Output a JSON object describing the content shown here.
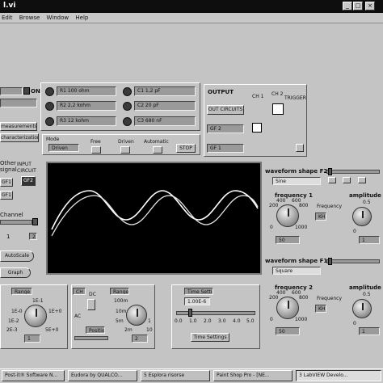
{
  "window": {
    "title": "l.vi",
    "btn_min": "_",
    "btn_max": "□",
    "btn_close": "×"
  },
  "menu": [
    "Edit",
    "Browse",
    "Window",
    "Help"
  ],
  "left": {
    "on_label": "ON",
    "measurements": "measurements",
    "characterization": "characterization",
    "other": "Other",
    "signal": "signal",
    "input_circuit": "INPUT CIRCUIT",
    "ch1": "CH 1",
    "gf1": "GF1",
    "gf2": "GF2",
    "gf1b": "GF1",
    "channel": "Channel",
    "ch_1": "1",
    "ch_2": "2",
    "autoscale": "AutoScale",
    "graph": "Graph"
  },
  "components": {
    "r1": "R1 100 ohm",
    "r2": "R2 2,2 kohm",
    "r3": "R3 12 kohm",
    "c1": "C1 1,2 pF",
    "c2": "C2 20 pF",
    "c3": "C3 680 nF"
  },
  "mode": {
    "label": "Mode",
    "value": "Driven",
    "free": "Free",
    "driven": "Driven",
    "automatic": "Automatic",
    "stop": "STOP"
  },
  "output": {
    "title": "OUTPUT",
    "circuits": "OUT CIRCUITS",
    "ch1": "CH 1",
    "ch2": "CH 2",
    "trigger": "TRIGGER",
    "gf2": "GF 2",
    "gf1": "GF 1"
  },
  "gen2": {
    "shape_label": "waveform shape F2",
    "shape_value": "Sine",
    "freq_label": "frequency 1",
    "amp_label": "amplitude",
    "freq_scale": [
      "200",
      "400",
      "600",
      "800",
      "0",
      "1000"
    ],
    "freq_unit_label": "Frequency",
    "freq_unit": "KHz",
    "freq_value": "50",
    "amp_scale": [
      "0.5",
      "0"
    ],
    "amp_value": "1"
  },
  "gen1": {
    "shape_label": "waveform shape F1",
    "shape_value": "Square",
    "freq_label": "frequency 2",
    "amp_label": "amplitude",
    "freq_scale": [
      "200",
      "400",
      "600",
      "800",
      "0",
      "1000"
    ],
    "freq_unit_label": "Frequency",
    "freq_unit": "KHz",
    "freq_value": "50",
    "amp_scale": [
      "0.5",
      "0"
    ],
    "amp_value": "1"
  },
  "bottom": {
    "range1": "Range",
    "range1_scale": [
      "1E-1",
      "1E-0",
      "1E-2",
      "1E+0",
      "2E-3",
      "5E+0"
    ],
    "range1_value": "1",
    "ch2": "CH 2",
    "dc": "DC",
    "ac": "AC",
    "position": "Position",
    "range2": "Range",
    "range2_scale": [
      "10m",
      "100m",
      "5m",
      "1",
      "2m",
      "10"
    ],
    "range2_value": "2",
    "time_setting": "Time Setting",
    "time_value": "1.00E-6",
    "time_scale": [
      "0.0",
      "1.0",
      "2.0",
      "3.0",
      "4.0",
      "5.0"
    ],
    "time_settings_btn": "Time Settings"
  },
  "taskbar": [
    "Post-it® Software N...",
    "Eudora by QUALCO...",
    "5 Esplora risorse",
    "Paint Shop Pro - [NE...",
    "3 LabVIEW Develo..."
  ]
}
